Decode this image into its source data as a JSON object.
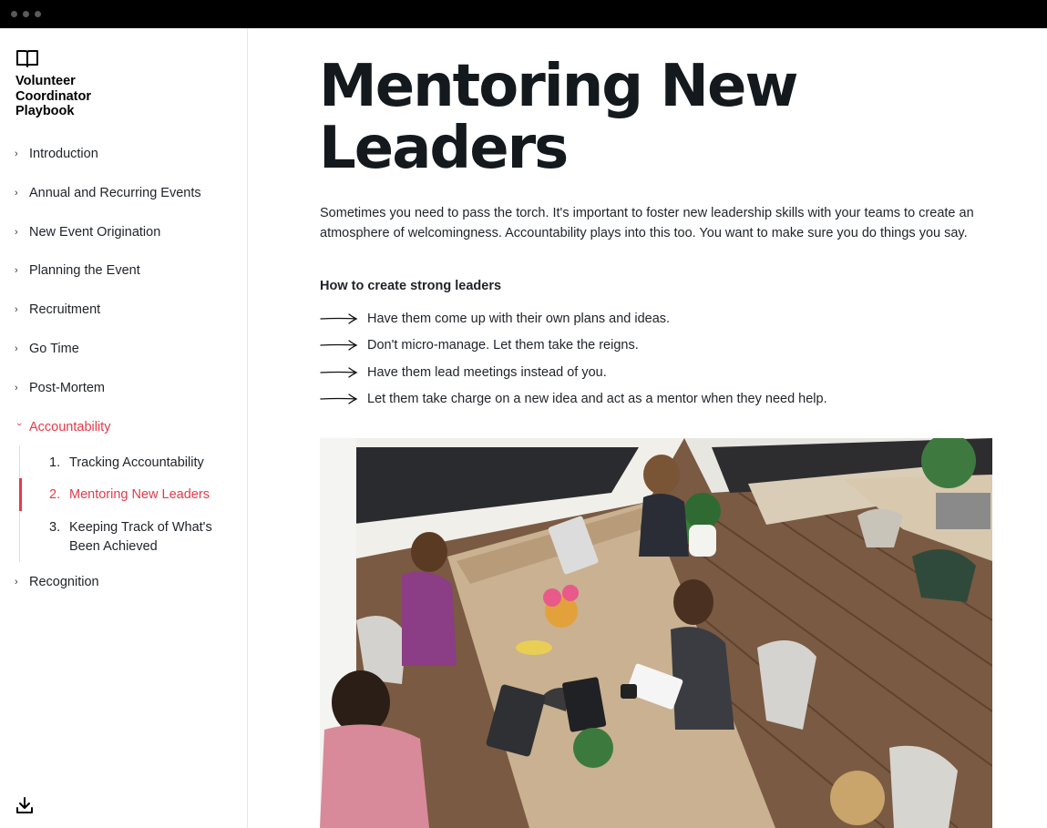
{
  "window": {
    "controls": [
      "dot",
      "dot",
      "dot"
    ]
  },
  "sidebar": {
    "logo_icon": "open-book-icon",
    "brand_lines": [
      "Volunteer",
      "Coordinator",
      "Playbook"
    ],
    "items": [
      {
        "label": "Introduction",
        "expanded": false
      },
      {
        "label": "Annual and Recurring Events",
        "expanded": false
      },
      {
        "label": "New Event Origination",
        "expanded": false
      },
      {
        "label": "Planning the Event",
        "expanded": false
      },
      {
        "label": "Recruitment",
        "expanded": false
      },
      {
        "label": "Go Time",
        "expanded": false
      },
      {
        "label": "Post-Mortem",
        "expanded": false
      },
      {
        "label": "Accountability",
        "expanded": true
      },
      {
        "label": "Recognition",
        "expanded": false
      }
    ],
    "subitems": [
      {
        "num": "1.",
        "label": "Tracking Accountability"
      },
      {
        "num": "2.",
        "label": "Mentoring New Leaders"
      },
      {
        "num": "3.",
        "label": "Keeping Track of What's Been Achieved"
      }
    ],
    "download_icon": "download-icon"
  },
  "main": {
    "title": "Mentoring New Leaders",
    "intro": "Sometimes you need to pass the torch. It's important to foster new leadership skills with your teams to create an atmosphere of welcomingness. Accountability plays into this too. You want to make sure you do things you say.",
    "subheading": "How to create strong leaders",
    "bullets": [
      "Have them come up with their own plans and ideas.",
      "Don't micro-manage. Let them take the reigns.",
      "Have them lead meetings instead of you.",
      "Let them take charge on a new idea and act as a mentor when they need help."
    ],
    "bullet_icon": "arrow-right-icon"
  },
  "colors": {
    "accent": "#e8394a",
    "titlebar": "#000000",
    "text": "#1f2328",
    "title": "#14191d"
  }
}
